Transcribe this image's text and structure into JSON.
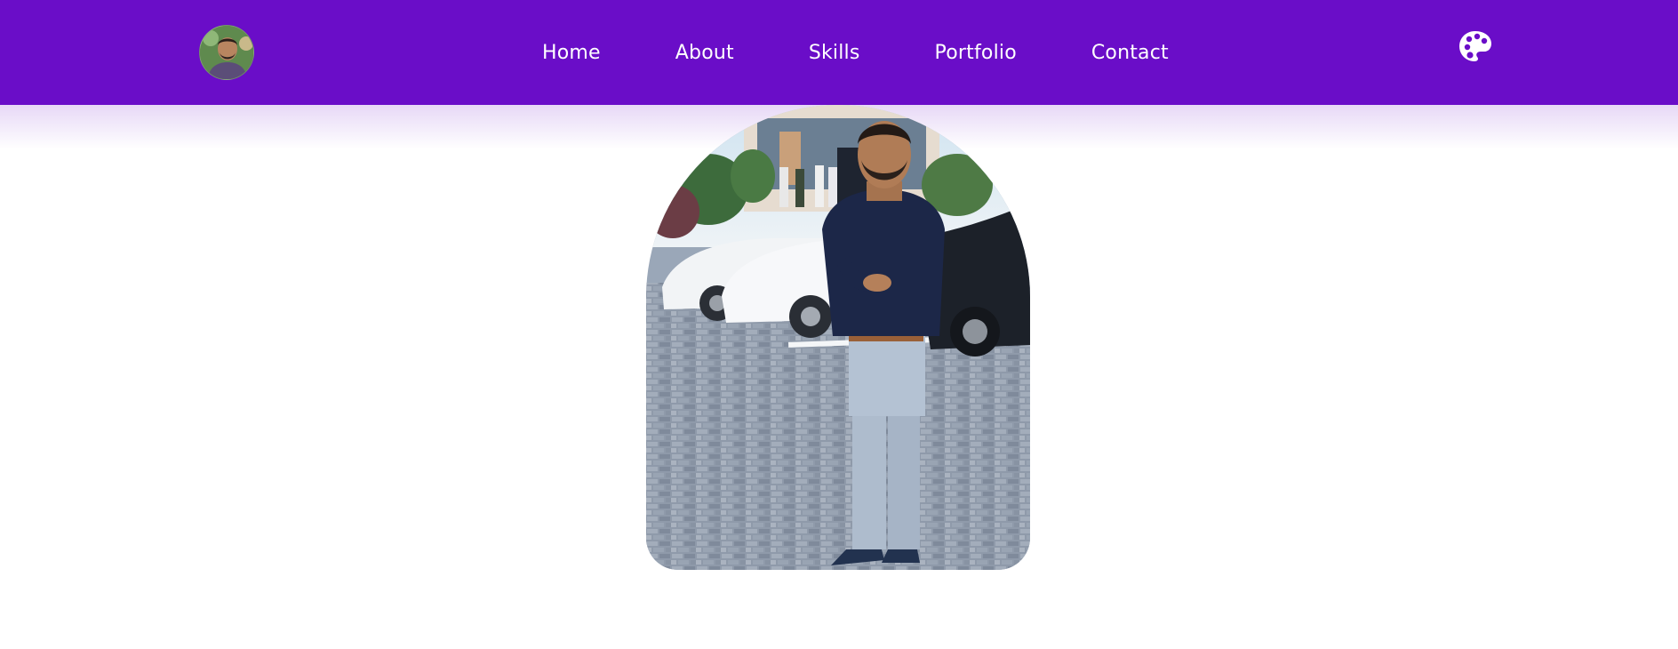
{
  "nav": {
    "links": [
      "Home",
      "About",
      "Skills",
      "Portfolio",
      "Contact"
    ]
  },
  "icons": {
    "avatar": "profile-avatar",
    "theme": "palette-icon"
  },
  "colors": {
    "navbar": "#6a0dc8",
    "nav_text": "#ffffff",
    "page_background": "#ffffff"
  }
}
